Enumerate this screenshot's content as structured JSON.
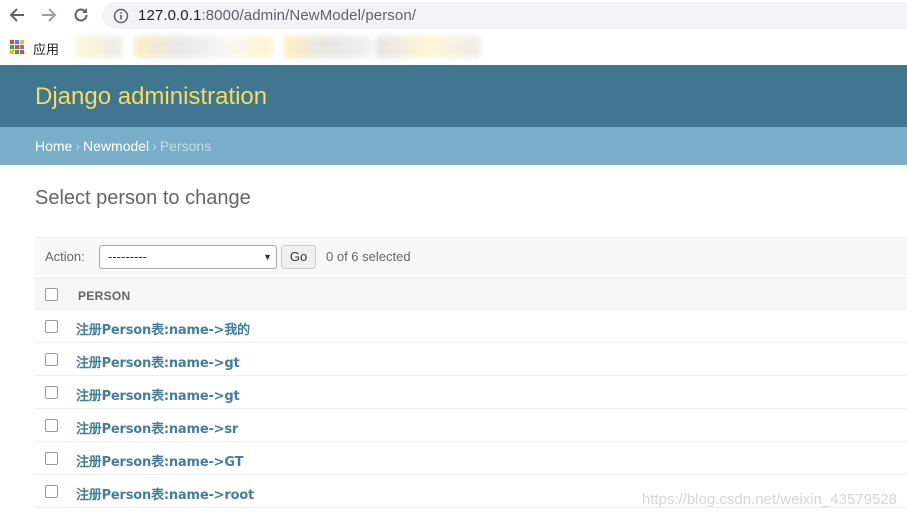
{
  "browser": {
    "url_host": "127.0.0.1",
    "url_rest": ":8000/admin/NewModel/person/",
    "apps_label": "应用"
  },
  "admin": {
    "branding": "Django administration",
    "breadcrumbs": {
      "home": "Home",
      "app": "Newmodel",
      "current": "Persons"
    },
    "page_title": "Select person to change",
    "actions": {
      "label": "Action:",
      "selected_option": "---------",
      "go_label": "Go",
      "selection_count": "0 of 6 selected"
    },
    "table": {
      "column_header": "PERSON",
      "rows": [
        "注册Person表:name->我的",
        "注册Person表:name->gt",
        "注册Person表:name->gt",
        "注册Person表:name->sr",
        "注册Person表:name->GT",
        "注册Person表:name->root"
      ]
    }
  },
  "watermark": "https://blog.csdn.net/weixin_43579528",
  "colors": {
    "header_bg": "#417690",
    "branding": "#f5dd5d",
    "breadcrumbs_bg": "#79aec8",
    "link": "#447e9b"
  }
}
